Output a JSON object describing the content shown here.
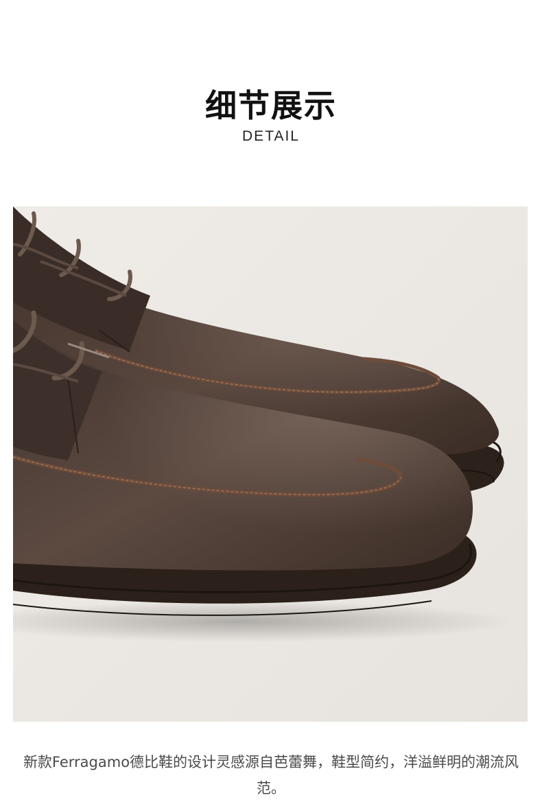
{
  "header": {
    "title_cn": "细节展示",
    "title_en": "DETAIL"
  },
  "product_image": {
    "subject": "brown-leather-derby-shoes",
    "colors": {
      "background": "#ece8e3",
      "leather": "#4a3a32",
      "stitching": "#7a5540",
      "sole": "#2e221c"
    }
  },
  "caption": {
    "text": "新款Ferragamo德比鞋的设计灵感源自芭蕾舞，鞋型简约，洋溢鲜明的潮流风范。"
  }
}
